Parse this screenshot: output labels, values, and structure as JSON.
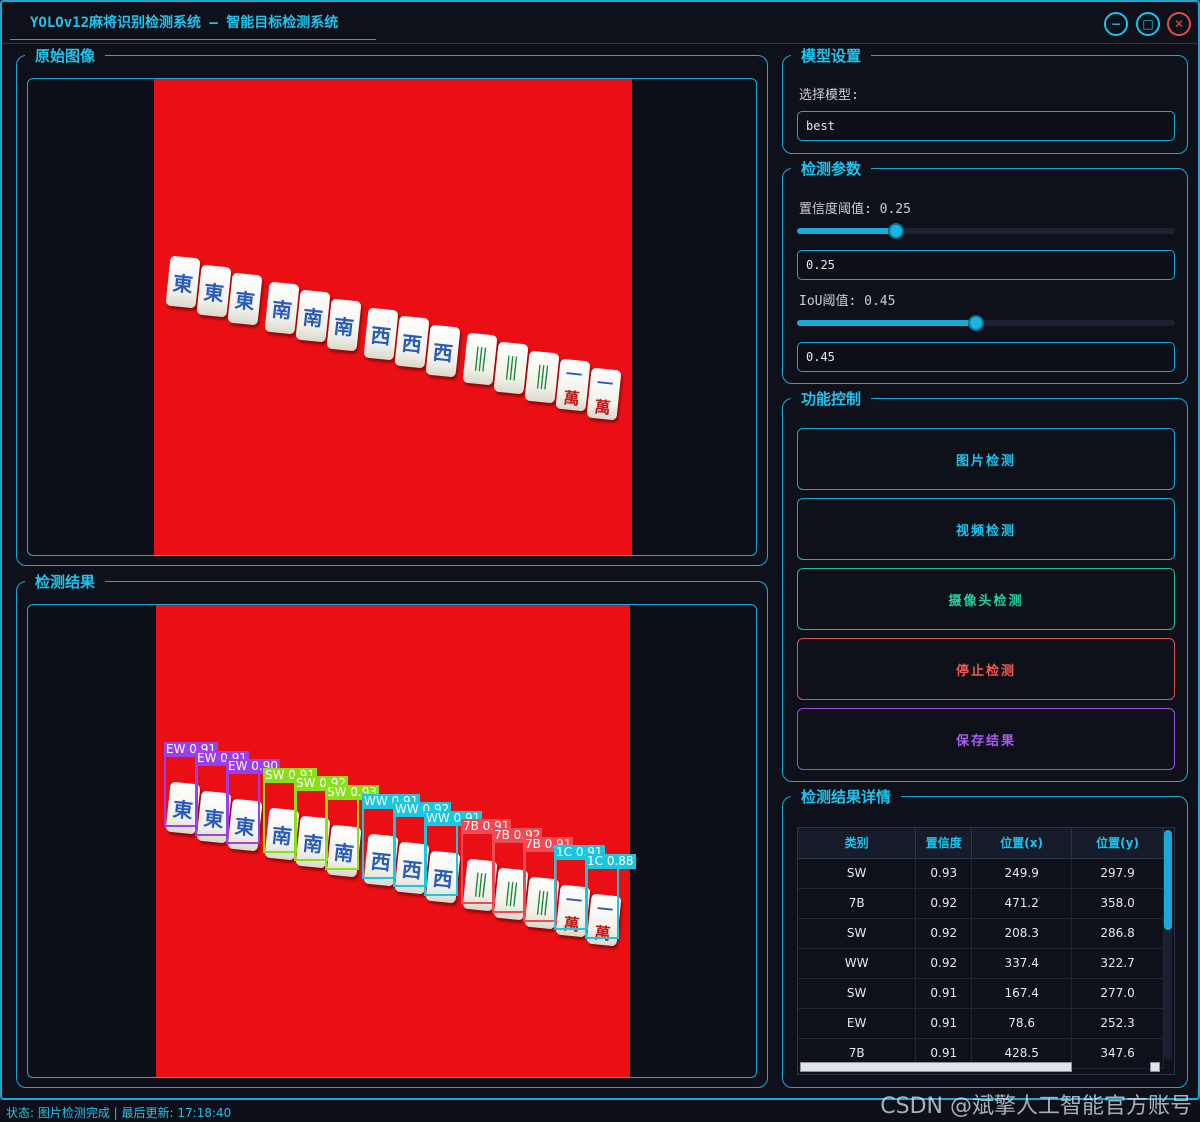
{
  "window": {
    "title": "YOLOv12麻将识别检测系统 – 智能目标检测系统"
  },
  "original_panel": {
    "title": "原始图像"
  },
  "result_panel": {
    "title": "检测结果"
  },
  "model_settings": {
    "title": "模型设置",
    "select_label": "选择模型:",
    "model_value": "best"
  },
  "detect_params": {
    "title": "检测参数",
    "conf_label": "置信度阈值: 0.25",
    "conf_value": "0.25",
    "conf_level": 0.25,
    "iou_label": "IoU阈值: 0.45",
    "iou_value": "0.45",
    "iou_level": 0.45
  },
  "function_control": {
    "title": "功能控制",
    "buttons": [
      {
        "label": "图片检测",
        "color": "#19a9d8",
        "text_color": "#1ec3ee"
      },
      {
        "label": "视频检测",
        "color": "#19a9d8",
        "text_color": "#1ec3ee"
      },
      {
        "label": "摄像头检测",
        "color": "#1fbf8f",
        "text_color": "#22d19c"
      },
      {
        "label": "停止检测",
        "color": "#e0504a",
        "text_color": "#ee5a52"
      },
      {
        "label": "保存结果",
        "color": "#9b4ee0",
        "text_color": "#a65cf0"
      }
    ]
  },
  "detail_panel": {
    "title": "检测结果详情",
    "columns": [
      "类别",
      "置信度",
      "位置(x)",
      "位置(y)"
    ],
    "rows": [
      [
        "SW",
        "0.93",
        "249.9",
        "297.9"
      ],
      [
        "7B",
        "0.92",
        "471.2",
        "358.0"
      ],
      [
        "SW",
        "0.92",
        "208.3",
        "286.8"
      ],
      [
        "WW",
        "0.92",
        "337.4",
        "322.7"
      ],
      [
        "SW",
        "0.91",
        "167.4",
        "277.0"
      ],
      [
        "EW",
        "0.91",
        "78.6",
        "252.3"
      ],
      [
        "7B",
        "0.91",
        "428.5",
        "347.6"
      ]
    ]
  },
  "tiles": {
    "east": "東",
    "south": "南",
    "west": "西",
    "bamboo": "|||",
    "wan_top": "一",
    "wan_bottom": "萬"
  },
  "detections": [
    {
      "label": "EW 0.91",
      "color": "#9d3fe8"
    },
    {
      "label": "EW 0.91",
      "color": "#9d3fe8"
    },
    {
      "label": "EW 0.90",
      "color": "#9d3fe8"
    },
    {
      "label": "SW 0.91",
      "color": "#88e01a"
    },
    {
      "label": "SW 0.92",
      "color": "#88e01a"
    },
    {
      "label": "SW 0.93",
      "color": "#88e01a"
    },
    {
      "label": "WW 0.91",
      "color": "#19c8e0"
    },
    {
      "label": "WW 0.92",
      "color": "#19c8e0"
    },
    {
      "label": "WW 0.91",
      "color": "#19c8e0"
    },
    {
      "label": "7B 0.91",
      "color": "#f04a55"
    },
    {
      "label": "7B 0.92",
      "color": "#f04a55"
    },
    {
      "label": "7B 0.91",
      "color": "#f04a55"
    },
    {
      "label": "1C 0.91",
      "color": "#19c8e0"
    },
    {
      "label": "1C 0.88",
      "color": "#19c8e0"
    }
  ],
  "status": {
    "text": "状态: 图片检测完成 | 最后更新: 17:18:40"
  },
  "watermark": "CSDN @斌擎人工智能官方账号"
}
